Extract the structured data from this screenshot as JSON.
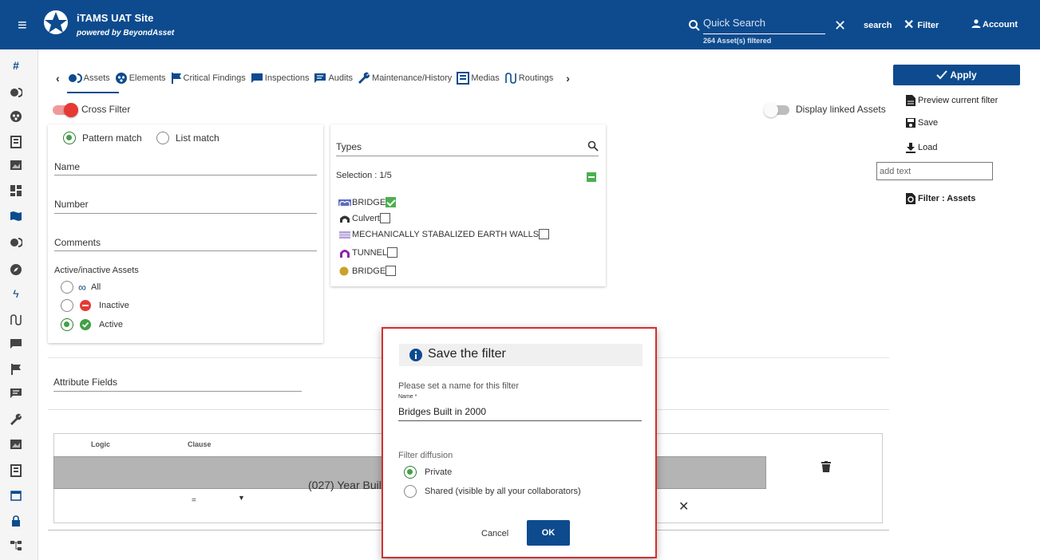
{
  "header": {
    "app_title": "iTAMS UAT Site",
    "app_subtitle": "powered by BeyondAsset",
    "search_placeholder": "Quick Search",
    "assets_filtered": "264 Asset(s) filtered",
    "search_label": "search",
    "filter_label": "Filter",
    "account_label": "Account"
  },
  "rail": {
    "hash": "#"
  },
  "tabs": [
    {
      "label": "Assets",
      "icon": "assets-icon"
    },
    {
      "label": "Elements",
      "icon": "elements-icon"
    },
    {
      "label": "Critical Findings",
      "icon": "flag-icon"
    },
    {
      "label": "Inspections",
      "icon": "comment-icon"
    },
    {
      "label": "Audits",
      "icon": "audit-icon"
    },
    {
      "label": "Maintenance/History",
      "icon": "wrench-icon"
    },
    {
      "label": "Medias",
      "icon": "media-icon"
    },
    {
      "label": "Routings",
      "icon": "routing-icon"
    }
  ],
  "filter": {
    "cross_filter_label": "Cross Filter",
    "cross_filter_on": true,
    "display_linked_label": "Display linked Assets",
    "display_linked_on": false,
    "pattern_match": "Pattern match",
    "list_match": "List match",
    "name_label": "Name",
    "number_label": "Number",
    "comments_label": "Comments",
    "active_inactive_label": "Active/inactive Assets",
    "all_label": "All",
    "inactive_label": "Inactive",
    "active_label": "Active"
  },
  "types": {
    "label": "Types",
    "selection": "Selection : 1/5",
    "items": [
      {
        "label": "BRIDGE",
        "checked": true,
        "color": "#5c6bc0"
      },
      {
        "label": "Culvert",
        "checked": false,
        "color": "#333333"
      },
      {
        "label": "MECHANICALLY STABALIZED EARTH WALLS",
        "checked": false,
        "color": "#b39ddb"
      },
      {
        "label": "TUNNEL",
        "checked": false,
        "color": "#8e24aa"
      },
      {
        "label": "BRIDGE",
        "checked": false,
        "color": "#c9a227"
      }
    ]
  },
  "right_panel": {
    "apply_label": "Apply",
    "preview_label": "Preview current filter",
    "save_label": "Save",
    "load_label": "Load",
    "add_text_placeholder": "add text",
    "filter_assets_label": "Filter : Assets"
  },
  "attributes": {
    "label": "Attribute Fields",
    "logic_header": "Logic",
    "clause_header": "Clause",
    "row_text": "(027) Year Built",
    "operator": "="
  },
  "dialog": {
    "title": "Save the filter",
    "prompt": "Please set a name for this filter",
    "name_label": "Name *",
    "name_value": "Bridges Built in 2000",
    "diffusion_label": "Filter diffusion",
    "private_label": "Private",
    "shared_label": "Shared (visible by all your collaborators)",
    "cancel_label": "Cancel",
    "ok_label": "OK"
  },
  "colors": {
    "brand": "#0d4b8e",
    "active_green": "#43a047",
    "inactive_red": "#e53935",
    "highlight_border": "#d32f2f"
  }
}
